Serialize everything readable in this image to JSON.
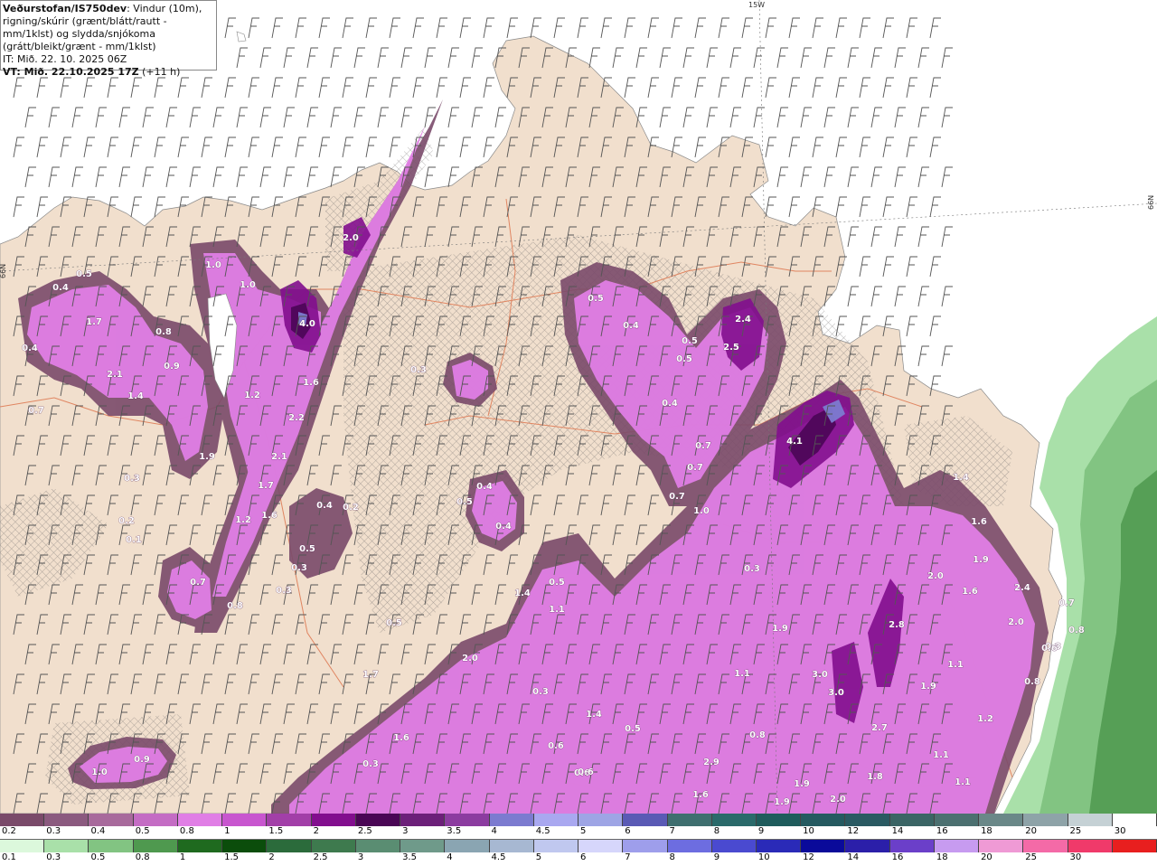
{
  "header": {
    "brand": "Veðurstofan/IS750dev",
    "desc": ": Vindur (10m), rigning/skúrir (grænt/blátt/rautt - mm/1klst) og slydda/snjókoma (grátt/bleikt/grænt - mm/1klst)",
    "init_time": "IT: Mið. 22. 10. 2025 06Z",
    "valid_time": "VT: Mið. 22.10.2025 17Z",
    "lead": " (+11 h)"
  },
  "grid_labels": {
    "lon_top": "15W",
    "lat_left": "66N",
    "lat_right": "66N"
  },
  "colors": {
    "sea": "#ffffff",
    "land": "#f1dfcd",
    "hatch": "#6d6a6a",
    "roads": "#e08561",
    "sleet_scale": [
      "#7a4a6a",
      "#8b5a7f",
      "#a86a9c",
      "#c46cc4",
      "#e07ee5",
      "#c856cf",
      "#a23fa8",
      "#820e8e",
      "#4a0655",
      "#6c2079",
      "#8c3ca0",
      "#7c7bd0",
      "#a9a8f0",
      "#9ea5e5",
      "#5a5ab5",
      "#3f6f6f",
      "#2a6a6a",
      "#1f5c5c",
      "#255a60",
      "#2a5a62",
      "#3b6565",
      "#4c7070",
      "#6a8888",
      "#8ea3a8",
      "#c5d1d5",
      "#ffffff"
    ],
    "rain_scale": [
      "#dcf8dc",
      "#a9e0a9",
      "#82c482",
      "#4f994f",
      "#1f6a1f",
      "#0b4d0b",
      "#2b6b3b",
      "#3e7a4e",
      "#5a8d72",
      "#6f9a8a",
      "#8aa5b2",
      "#a7b8d2",
      "#c0c8ef",
      "#d6d6fb",
      "#9e9eeb",
      "#6d6de0",
      "#4a4ad0",
      "#2a2ab8",
      "#0a0a9a",
      "#2b1fa9",
      "#6b3fc9",
      "#c79bf0",
      "#ef9ad5",
      "#f46aa7",
      "#f03a6a",
      "#e81f1f"
    ]
  },
  "legend": {
    "sleet_labels": [
      "0.2",
      "0.3",
      "0.4",
      "0.5",
      "0.8",
      "1",
      "1.5",
      "2",
      "2.5",
      "3",
      "3.5",
      "4",
      "4.5",
      "5",
      "6",
      "7",
      "8",
      "9",
      "10",
      "12",
      "14",
      "16",
      "18",
      "20",
      "25",
      "30"
    ],
    "rain_labels": [
      "0.1",
      "0.3",
      "0.5",
      "0.8",
      "1",
      "1.5",
      "2",
      "2.5",
      "3",
      "3.5",
      "4",
      "4.5",
      "5",
      "6",
      "7",
      "8",
      "9",
      "10",
      "12",
      "14",
      "16",
      "18",
      "20",
      "25",
      "30"
    ]
  },
  "precip_labels": [
    "0.5",
    "0.4",
    "1.7",
    "0.8",
    "0.4",
    "2.1",
    "0.9",
    "1.4",
    "0.7",
    "1.9",
    "1.0",
    "1.0",
    "4.0",
    "1.2",
    "1.6",
    "2.2",
    "2.1",
    "1.7",
    "1.6",
    "1.2",
    "0.4",
    "0.2",
    "0.5",
    "0.3",
    "0.7",
    "0.8",
    "0.2",
    "0.3",
    "2.0",
    "0.3",
    "0.5",
    "1.7",
    "0.4",
    "0.5",
    "0.4",
    "0.5",
    "0.4",
    "2.4",
    "2.5",
    "0.5",
    "0.5",
    "0.4",
    "0.7",
    "0.7",
    "0.7",
    "1.0",
    "4.1",
    "0.3",
    "1.4",
    "0.5",
    "1.1",
    "1.9",
    "1.1",
    "2.0",
    "0.3",
    "1.6",
    "1.9",
    "1.6",
    "2.0",
    "2.4",
    "2.0",
    "2.8",
    "3.0",
    "3.0",
    "0.6",
    "1.1",
    "1.9",
    "1.2",
    "0.6",
    "1.4",
    "0.5",
    "0.3",
    "1.6",
    "0.8",
    "0.9",
    "1.0",
    "0.6",
    "2.9",
    "1.6",
    "1.9",
    "1.9",
    "2.0",
    "0.8",
    "2.7",
    "1.8",
    "1.1",
    "1.1",
    "0.8",
    "0.6",
    "0.8",
    "0.7",
    "1.4",
    "0.3",
    "0.1"
  ]
}
